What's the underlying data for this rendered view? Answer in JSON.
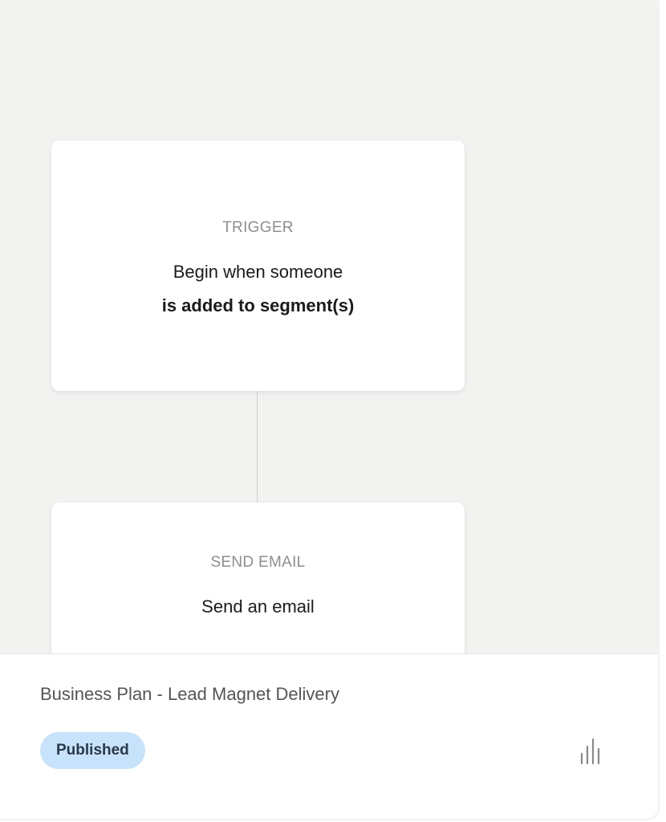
{
  "workflow": {
    "nodes": [
      {
        "type_label": "TRIGGER",
        "description_line1": "Begin when someone",
        "description_line2": "is added to segment(s)"
      },
      {
        "type_label": "SEND EMAIL",
        "description_line1": "Send an email"
      }
    ]
  },
  "footer": {
    "title": "Business Plan - Lead Magnet Delivery",
    "status": "Published",
    "status_color": "#c7e2fb",
    "stats_icon": "bar-chart-icon"
  }
}
